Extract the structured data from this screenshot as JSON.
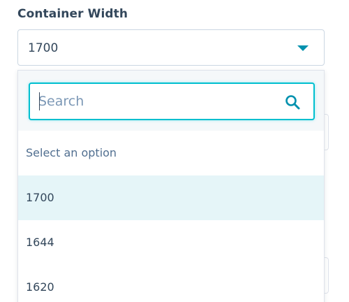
{
  "field": {
    "label": "Container Width",
    "value": "1700"
  },
  "search": {
    "placeholder": "Search",
    "value": ""
  },
  "options": [
    {
      "label": "Select an option",
      "selected": false
    },
    {
      "label": "1700",
      "selected": true
    },
    {
      "label": "1644",
      "selected": false
    },
    {
      "label": "1620",
      "selected": false
    }
  ],
  "colors": {
    "accent": "#0091ae",
    "focus_border": "#00bfcf",
    "selected_bg": "#e5f5f8",
    "text": "#33475b"
  },
  "icons": {
    "dropdown": "caret-down-icon",
    "search": "magnifier-icon"
  }
}
